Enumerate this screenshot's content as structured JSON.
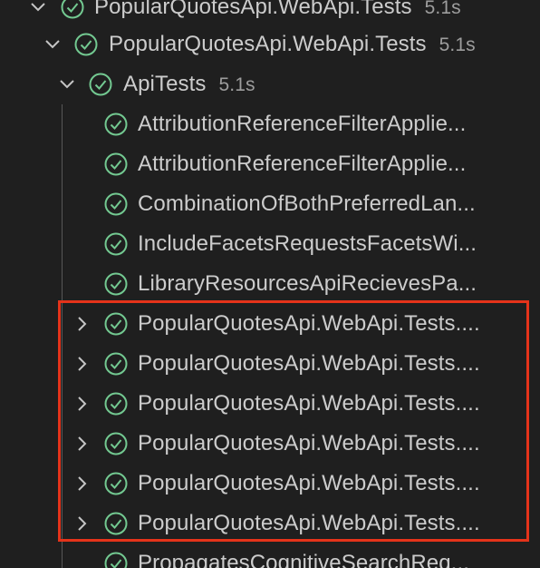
{
  "tree": {
    "root": {
      "label": "PopularQuotesApi.WebApi.Tests",
      "duration": "5.1s",
      "expanded": true,
      "status": "passed"
    },
    "project": {
      "label": "PopularQuotesApi.WebApi.Tests",
      "duration": "5.1s",
      "expanded": true,
      "status": "passed"
    },
    "class": {
      "label": "ApiTests",
      "duration": "5.1s",
      "expanded": true,
      "status": "passed"
    },
    "tests": [
      {
        "label": "AttributionReferenceFilterApplie...",
        "status": "passed",
        "expandable": false
      },
      {
        "label": "AttributionReferenceFilterApplie...",
        "status": "passed",
        "expandable": false
      },
      {
        "label": "CombinationOfBothPreferredLan...",
        "status": "passed",
        "expandable": false
      },
      {
        "label": "IncludeFacetsRequestsFacetsWi...",
        "status": "passed",
        "expandable": false
      },
      {
        "label": "LibraryResourcesApiRecievesPa...",
        "status": "passed",
        "expandable": false
      },
      {
        "label": "PopularQuotesApi.WebApi.Tests....",
        "status": "passed",
        "expandable": true
      },
      {
        "label": "PopularQuotesApi.WebApi.Tests....",
        "status": "passed",
        "expandable": true
      },
      {
        "label": "PopularQuotesApi.WebApi.Tests....",
        "status": "passed",
        "expandable": true
      },
      {
        "label": "PopularQuotesApi.WebApi.Tests....",
        "status": "passed",
        "expandable": true
      },
      {
        "label": "PopularQuotesApi.WebApi.Tests....",
        "status": "passed",
        "expandable": true
      },
      {
        "label": "PopularQuotesApi.WebApi.Tests....",
        "status": "passed",
        "expandable": true
      },
      {
        "label": "PropagatesCognitiveSearchReq...",
        "status": "passed",
        "expandable": false
      }
    ]
  },
  "colors": {
    "background": "#1f1f1f",
    "text": "#cccccc",
    "duration": "#9d9d9d",
    "pass": "#73c991",
    "highlight": "#e5331a"
  },
  "icons": {
    "pass": "check-circle-icon",
    "expanded": "chevron-down-icon",
    "collapsed": "chevron-right-icon"
  }
}
